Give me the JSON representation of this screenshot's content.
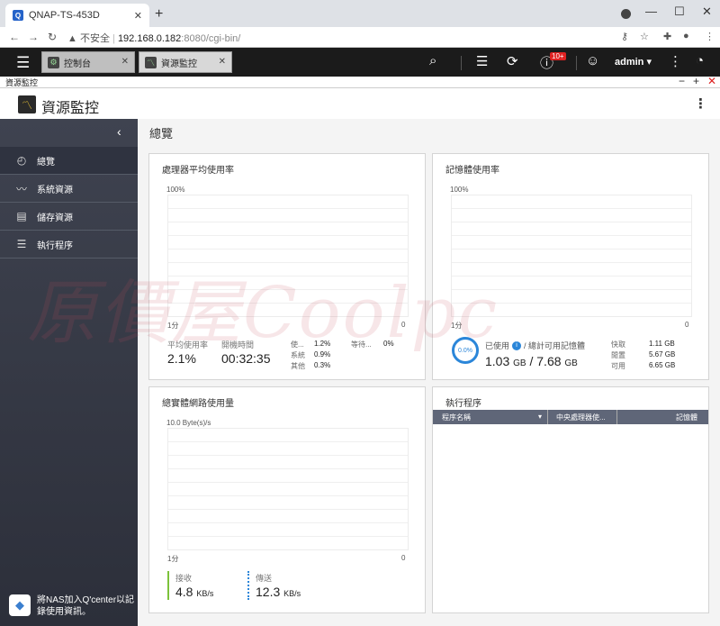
{
  "browser": {
    "tab_title": "QNAP-TS-453D",
    "tab_favicon": "Q",
    "new_tab": "+",
    "security_label": "不安全",
    "url_host": "192.168.0.182",
    "url_rest": ":8080/cgi-bin/"
  },
  "qts": {
    "tabs": [
      {
        "label": "控制台",
        "icon": "gear-icon"
      },
      {
        "label": "資源監控",
        "icon": "monitor-icon"
      }
    ],
    "notification_badge": "10+",
    "user": "admin ▾"
  },
  "window": {
    "title": "資源監控"
  },
  "app": {
    "title": "資源監控",
    "logo_glyph": "〽"
  },
  "sidebar": {
    "items": [
      {
        "label": "總覽",
        "icon": "dashboard-icon"
      },
      {
        "label": "系統資源",
        "icon": "chart-line-icon"
      },
      {
        "label": "儲存資源",
        "icon": "storage-icon"
      },
      {
        "label": "執行程序",
        "icon": "process-list-icon"
      }
    ],
    "qcenter": "將NAS加入Q'center以記錄使用資訊。"
  },
  "main": {
    "page_title": "總覽",
    "cpu": {
      "title": "處理器平均使用率",
      "y_max": "100%",
      "x_left": "1分",
      "x_right": "0",
      "avg_label": "平均使用率",
      "avg_value": "2.1%",
      "uptime_label": "開機時間",
      "uptime_value": "00:32:35",
      "breakdown": [
        {
          "label": "使...",
          "value": "1.2%"
        },
        {
          "label": "系統",
          "value": "0.9%"
        },
        {
          "label": "其他",
          "value": "0.3%"
        }
      ],
      "wait_label": "等待...",
      "wait_value": "0%"
    },
    "memory": {
      "title": "記憶體使用率",
      "y_max": "100%",
      "x_left": "1分",
      "x_right": "0",
      "ring_value": "0.0%",
      "used_label": "已使用",
      "total_label": "/ 總計可用記憶體",
      "used": "1.03",
      "total": "7.68",
      "unit": "GB",
      "details": [
        {
          "label": "快取",
          "value": "1.11 GB"
        },
        {
          "label": "閒置",
          "value": "5.67 GB"
        },
        {
          "label": "可用",
          "value": "6.65 GB"
        }
      ]
    },
    "network": {
      "title": "總實體網路使用量",
      "y_max": "10.0 Byte(s)/s",
      "x_left": "1分",
      "x_right": "0",
      "rx_label": "接收",
      "rx_value": "4.8",
      "tx_label": "傳送",
      "tx_value": "12.3",
      "unit": "KB/s",
      "rx_color": "#7cc23a",
      "tx_color": "#2b86d9"
    },
    "processes": {
      "title": "執行程序",
      "columns": [
        "程序名稱",
        "中央處理器使...",
        "記憶體"
      ]
    }
  },
  "watermark": "原價屋Coolpc"
}
